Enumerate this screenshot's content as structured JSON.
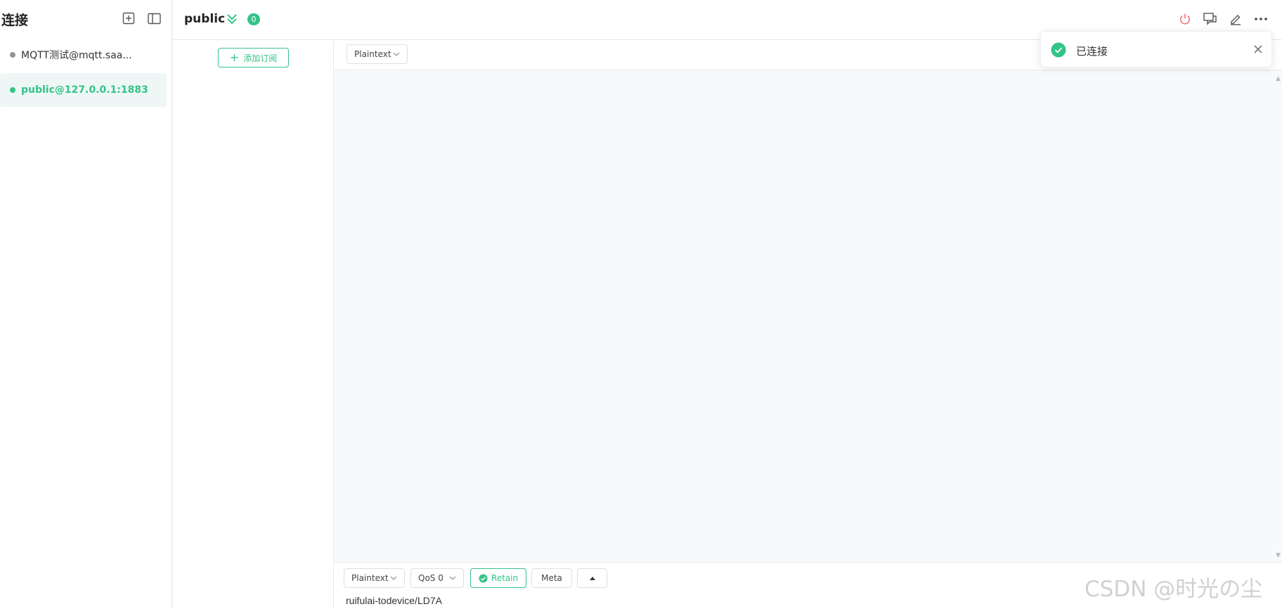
{
  "colors": {
    "accent": "#34c388",
    "danger": "#f56c6c",
    "offline_dot": "#909399",
    "active_bg": "#eef7f6"
  },
  "sidebar": {
    "title": "连接",
    "add_icon": "plus-square-icon",
    "toggle_icon": "sidebar-toggle-icon",
    "connections": [
      {
        "label": "MQTT测试@mqtt.saa...",
        "status": "offline",
        "active": false
      },
      {
        "label": "public@127.0.0.1:1883",
        "status": "online",
        "active": true
      }
    ]
  },
  "header": {
    "connection_name": "public",
    "unread_count": "0",
    "icons": [
      "chevrons-down-icon",
      "power-icon",
      "chat-icon",
      "edit-icon",
      "more-icon"
    ]
  },
  "subscriptions": {
    "add_button_label": "添加订阅"
  },
  "messages": {
    "format_select": "Plaintext"
  },
  "publish": {
    "format_select": "Plaintext",
    "qos_select": "QoS 0",
    "retain_label": "Retain",
    "meta_label": "Meta",
    "topic_value": "ruifulai-todevice/LD7A"
  },
  "toast": {
    "message": "已连接"
  },
  "watermark": "CSDN @时光の尘"
}
